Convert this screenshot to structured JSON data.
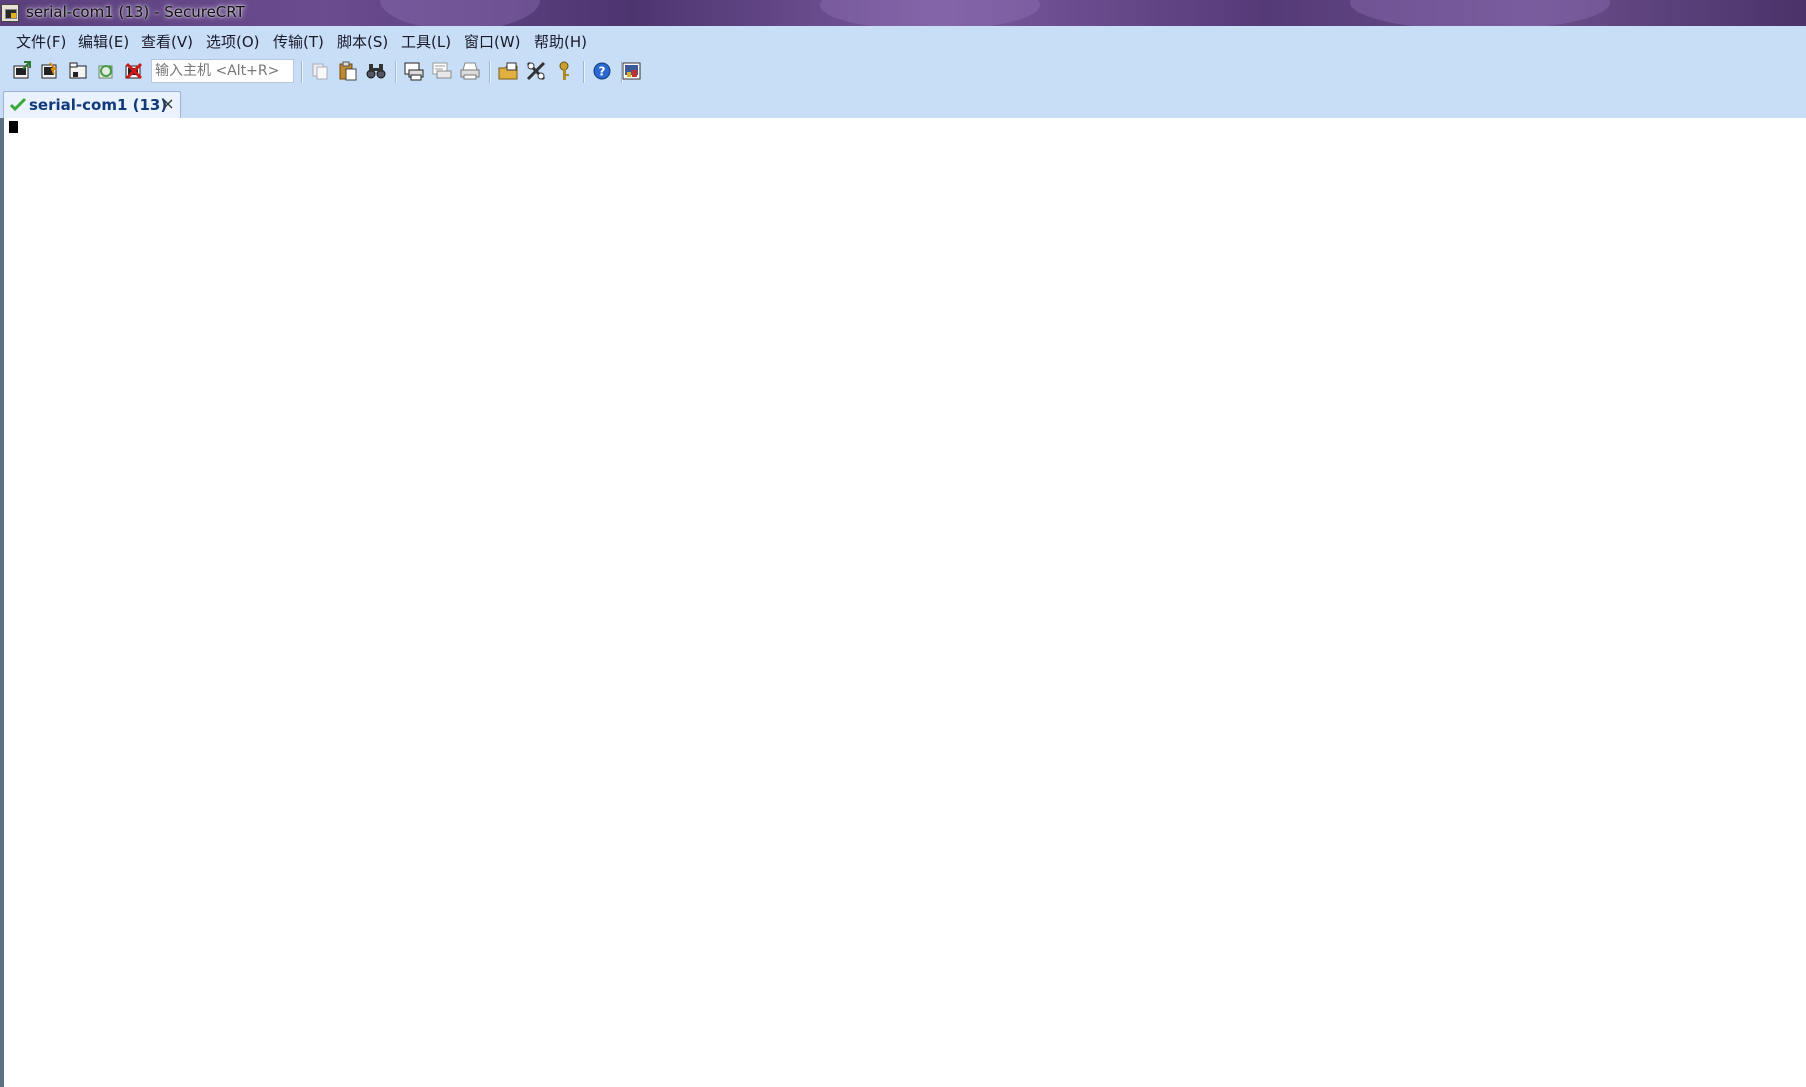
{
  "window": {
    "title": "serial-com1 (13) - SecureCRT",
    "app_icon": "securecrt-icon"
  },
  "menu": {
    "items": [
      {
        "label": "文件(F)"
      },
      {
        "label": "编辑(E)"
      },
      {
        "label": "查看(V)"
      },
      {
        "label": "选项(O)"
      },
      {
        "label": "传输(T)"
      },
      {
        "label": "脚本(S)"
      },
      {
        "label": "工具(L)"
      },
      {
        "label": "窗口(W)"
      },
      {
        "label": "帮助(H)"
      }
    ]
  },
  "toolbar": {
    "host_placeholder": "输入主机 <Alt+R>",
    "icons": [
      "connect-icon",
      "quick-connect-icon",
      "connect-in-tab-icon",
      "reconnect-icon",
      "disconnect-icon",
      "copy-icon",
      "paste-icon",
      "find-icon",
      "print-screen-icon",
      "print-selection-icon",
      "print-icon",
      "session-options-icon",
      "global-options-icon",
      "keymap-icon",
      "help-icon",
      "about-icon"
    ]
  },
  "tabs": [
    {
      "label": "serial-com1 (13)",
      "status": "connected"
    }
  ],
  "colors": {
    "chrome": "#c8def7",
    "tab_text": "#123a7a",
    "terminal_bg": "#ffffff"
  }
}
